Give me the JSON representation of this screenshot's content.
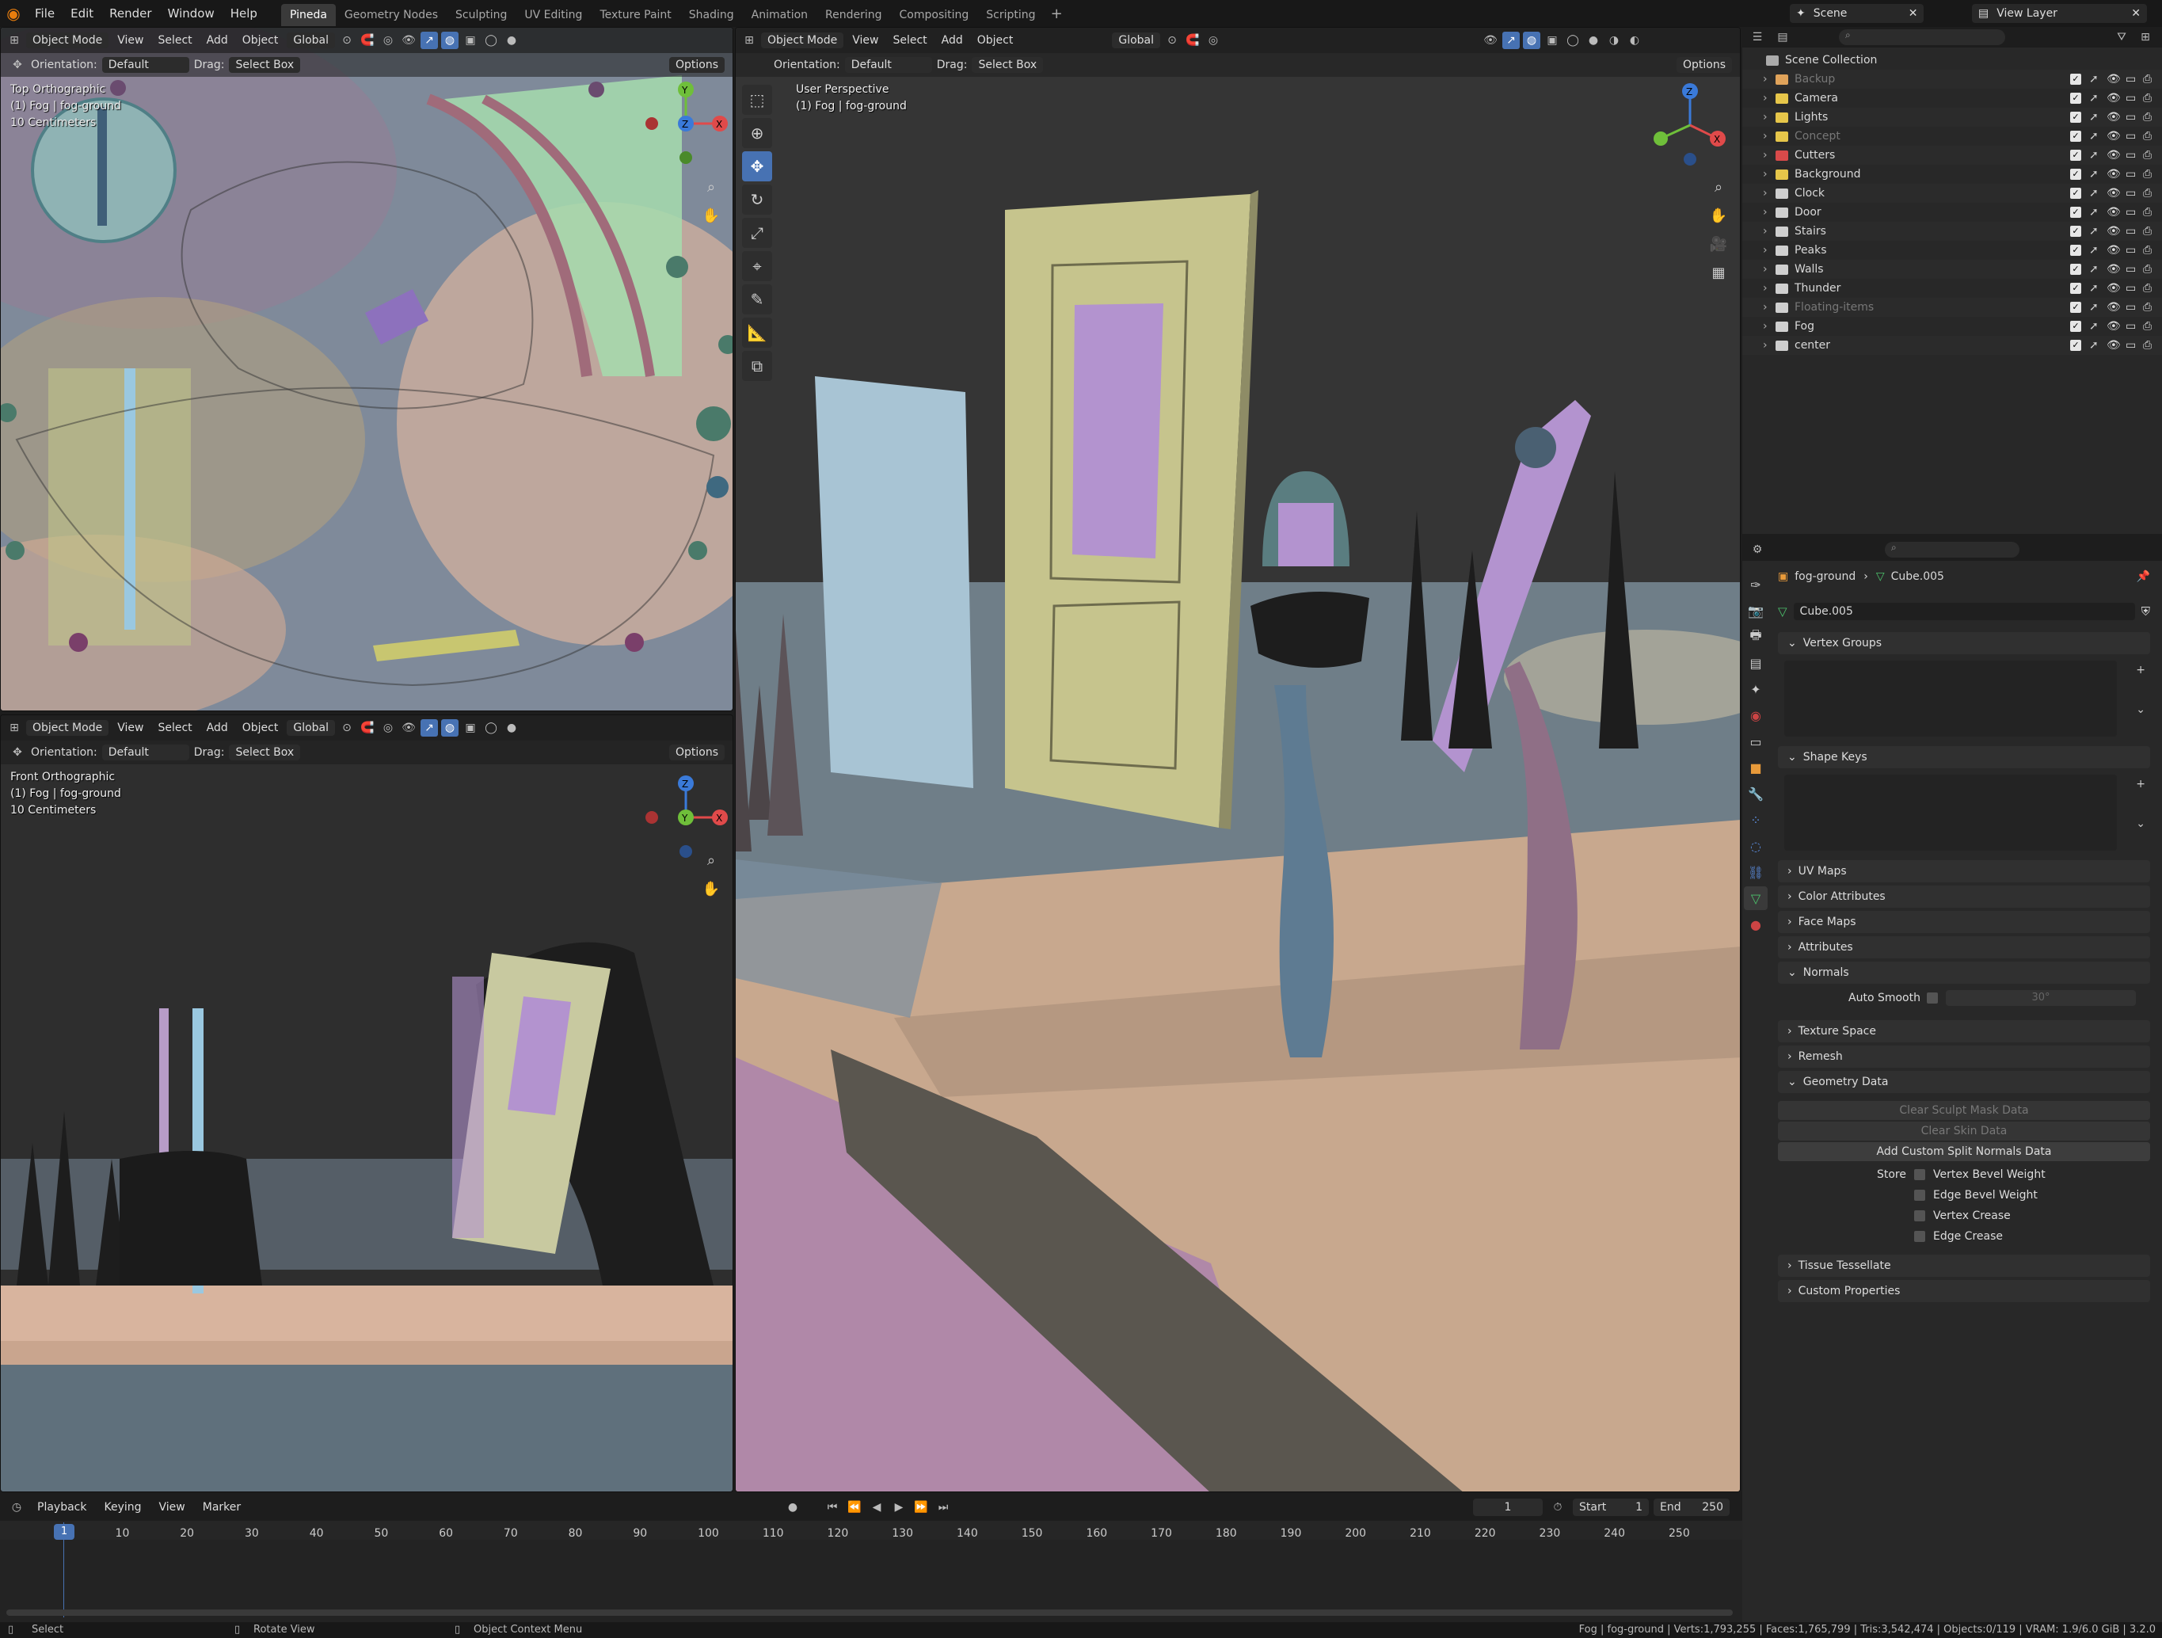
{
  "topmenu": {
    "items": [
      "File",
      "Edit",
      "Render",
      "Window",
      "Help"
    ]
  },
  "workspaces": {
    "tabs": [
      "Pineda",
      "Geometry Nodes",
      "Sculpting",
      "UV Editing",
      "Texture Paint",
      "Shading",
      "Animation",
      "Rendering",
      "Compositing",
      "Scripting"
    ],
    "active": "Pineda"
  },
  "scene": {
    "name": "Scene",
    "view_layer": "View Layer"
  },
  "viewport_header": {
    "mode": "Object Mode",
    "view": "View",
    "select": "Select",
    "add": "Add",
    "object": "Object",
    "transform": "Global",
    "options": "Options",
    "orientation_label": "Orientation:",
    "orientation_value": "Default",
    "drag_label": "Drag:",
    "drag_value": "Select Box"
  },
  "vp_top": {
    "view_name": "Top Orthographic",
    "object": "(1) Fog | fog-ground",
    "scale": "10 Centimeters"
  },
  "vp_front": {
    "view_name": "Front Orthographic",
    "object": "(1) Fog | fog-ground",
    "scale": "10 Centimeters"
  },
  "vp_persp": {
    "view_name": "User Perspective",
    "object": "(1) Fog | fog-ground"
  },
  "outliner": {
    "root": "Scene Collection",
    "items": [
      {
        "name": "Backup",
        "color": "#e0a35a",
        "dim": true
      },
      {
        "name": "Camera",
        "color": "#e6c64a",
        "dim": false
      },
      {
        "name": "Lights",
        "color": "#e6c64a",
        "dim": false
      },
      {
        "name": "Concept",
        "color": "#e6c64a",
        "dim": true
      },
      {
        "name": "Cutters",
        "color": "#d94a4a",
        "dim": false
      },
      {
        "name": "Background",
        "color": "#e6c64a",
        "dim": false
      },
      {
        "name": "Clock",
        "color": "#cfcfcf",
        "dim": false
      },
      {
        "name": "Door",
        "color": "#cfcfcf",
        "dim": false
      },
      {
        "name": "Stairs",
        "color": "#cfcfcf",
        "dim": false
      },
      {
        "name": "Peaks",
        "color": "#cfcfcf",
        "dim": false
      },
      {
        "name": "Walls",
        "color": "#cfcfcf",
        "dim": false
      },
      {
        "name": "Thunder",
        "color": "#cfcfcf",
        "dim": false
      },
      {
        "name": "Floating-items",
        "color": "#cfcfcf",
        "dim": true
      },
      {
        "name": "Fog",
        "color": "#cfcfcf",
        "dim": false
      },
      {
        "name": "center",
        "color": "#cfcfcf",
        "dim": false
      }
    ]
  },
  "properties": {
    "object": "fog-ground",
    "mesh": "Cube.005",
    "datablock": "Cube.005",
    "panels": {
      "vertex_groups": "Vertex Groups",
      "shape_keys": "Shape Keys",
      "uv_maps": "UV Maps",
      "color_attributes": "Color Attributes",
      "face_maps": "Face Maps",
      "attributes": "Attributes",
      "normals": "Normals",
      "auto_smooth": "Auto Smooth",
      "auto_smooth_angle": "30°",
      "texture_space": "Texture Space",
      "remesh": "Remesh",
      "geometry_data": "Geometry Data",
      "clear_sculpt": "Clear Sculpt Mask Data",
      "clear_skin": "Clear Skin Data",
      "add_split": "Add Custom Split Normals Data",
      "store": "Store",
      "vertex_bevel": "Vertex Bevel Weight",
      "edge_bevel": "Edge Bevel Weight",
      "vertex_crease": "Vertex Crease",
      "edge_crease": "Edge Crease",
      "tissue": "Tissue Tessellate",
      "custom_props": "Custom Properties"
    }
  },
  "timeline": {
    "menus": [
      "Playback",
      "Keying",
      "View",
      "Marker"
    ],
    "current_frame": "1",
    "start_label": "Start",
    "start": "1",
    "end_label": "End",
    "end": "250",
    "ticks": [
      "1",
      "10",
      "20",
      "30",
      "40",
      "50",
      "60",
      "70",
      "80",
      "90",
      "100",
      "110",
      "120",
      "130",
      "140",
      "150",
      "160",
      "170",
      "180",
      "190",
      "200",
      "210",
      "220",
      "230",
      "240",
      "250"
    ]
  },
  "status": {
    "select": "Select",
    "rotate": "Rotate View",
    "context": "Object Context Menu",
    "stats": "Fog | fog-ground | Verts:1,793,255 | Faces:1,765,799 | Tris:3,542,474 | Objects:0/119 | VRAM: 1.9/6.0 GiB | 3.2.0"
  },
  "colors": {
    "accent": "#4772b3",
    "header_bg": "#1d1d1d",
    "panel_bg": "#282828"
  }
}
